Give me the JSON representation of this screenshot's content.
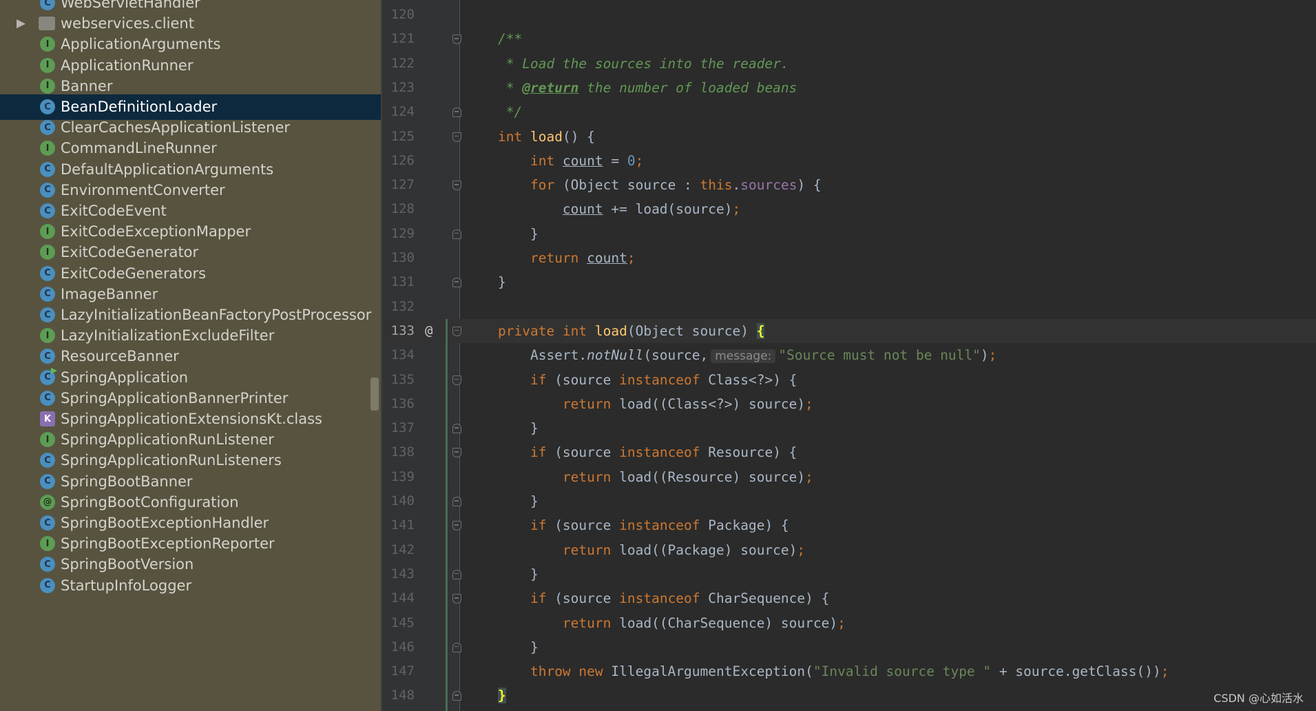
{
  "sidebar": {
    "items": [
      {
        "label": "WebServletHandler",
        "icon": "class-icon",
        "kind": "class",
        "badge": "C",
        "selected": false,
        "arrow": ""
      },
      {
        "label": "webservices.client",
        "icon": "package-icon",
        "kind": "package",
        "badge": "",
        "selected": false,
        "arrow": "▶"
      },
      {
        "label": "ApplicationArguments",
        "icon": "interface-icon",
        "kind": "interface",
        "badge": "I",
        "selected": false,
        "arrow": ""
      },
      {
        "label": "ApplicationRunner",
        "icon": "interface-icon",
        "kind": "interface",
        "badge": "I",
        "selected": false,
        "arrow": ""
      },
      {
        "label": "Banner",
        "icon": "interface-icon",
        "kind": "interface",
        "badge": "I",
        "selected": false,
        "arrow": ""
      },
      {
        "label": "BeanDefinitionLoader",
        "icon": "class-icon",
        "kind": "class",
        "badge": "C",
        "selected": true,
        "arrow": ""
      },
      {
        "label": "ClearCachesApplicationListener",
        "icon": "class-icon",
        "kind": "class",
        "badge": "C",
        "selected": false,
        "arrow": ""
      },
      {
        "label": "CommandLineRunner",
        "icon": "interface-icon",
        "kind": "interface",
        "badge": "I",
        "selected": false,
        "arrow": ""
      },
      {
        "label": "DefaultApplicationArguments",
        "icon": "class-icon",
        "kind": "class",
        "badge": "C",
        "selected": false,
        "arrow": ""
      },
      {
        "label": "EnvironmentConverter",
        "icon": "class-icon",
        "kind": "class",
        "badge": "C",
        "selected": false,
        "arrow": ""
      },
      {
        "label": "ExitCodeEvent",
        "icon": "class-icon",
        "kind": "class",
        "badge": "C",
        "selected": false,
        "arrow": ""
      },
      {
        "label": "ExitCodeExceptionMapper",
        "icon": "interface-icon",
        "kind": "interface",
        "badge": "I",
        "selected": false,
        "arrow": ""
      },
      {
        "label": "ExitCodeGenerator",
        "icon": "interface-icon",
        "kind": "interface",
        "badge": "I",
        "selected": false,
        "arrow": ""
      },
      {
        "label": "ExitCodeGenerators",
        "icon": "class-icon",
        "kind": "class",
        "badge": "C",
        "selected": false,
        "arrow": ""
      },
      {
        "label": "ImageBanner",
        "icon": "class-icon",
        "kind": "class",
        "badge": "C",
        "selected": false,
        "arrow": ""
      },
      {
        "label": "LazyInitializationBeanFactoryPostProcessor",
        "icon": "class-icon",
        "kind": "class",
        "badge": "C",
        "selected": false,
        "arrow": ""
      },
      {
        "label": "LazyInitializationExcludeFilter",
        "icon": "interface-icon",
        "kind": "interface",
        "badge": "I",
        "selected": false,
        "arrow": ""
      },
      {
        "label": "ResourceBanner",
        "icon": "class-icon",
        "kind": "class",
        "badge": "C",
        "selected": false,
        "arrow": ""
      },
      {
        "label": "SpringApplication",
        "icon": "main-class-icon",
        "kind": "class main",
        "badge": "C",
        "selected": false,
        "arrow": ""
      },
      {
        "label": "SpringApplicationBannerPrinter",
        "icon": "class-icon",
        "kind": "class",
        "badge": "C",
        "selected": false,
        "arrow": ""
      },
      {
        "label": "SpringApplicationExtensionsKt.class",
        "icon": "kotlin-file-icon",
        "kind": "kotlin",
        "badge": "K",
        "selected": false,
        "arrow": ""
      },
      {
        "label": "SpringApplicationRunListener",
        "icon": "interface-icon",
        "kind": "interface",
        "badge": "I",
        "selected": false,
        "arrow": ""
      },
      {
        "label": "SpringApplicationRunListeners",
        "icon": "class-icon",
        "kind": "class",
        "badge": "C",
        "selected": false,
        "arrow": ""
      },
      {
        "label": "SpringBootBanner",
        "icon": "class-icon",
        "kind": "class",
        "badge": "C",
        "selected": false,
        "arrow": ""
      },
      {
        "label": "SpringBootConfiguration",
        "icon": "annotation-icon",
        "kind": "annotation",
        "badge": "@",
        "selected": false,
        "arrow": ""
      },
      {
        "label": "SpringBootExceptionHandler",
        "icon": "class-icon",
        "kind": "class",
        "badge": "C",
        "selected": false,
        "arrow": ""
      },
      {
        "label": "SpringBootExceptionReporter",
        "icon": "interface-icon",
        "kind": "interface",
        "badge": "I",
        "selected": false,
        "arrow": ""
      },
      {
        "label": "SpringBootVersion",
        "icon": "class-icon",
        "kind": "class",
        "badge": "C",
        "selected": false,
        "arrow": ""
      },
      {
        "label": "StartupInfoLogger",
        "icon": "class-icon",
        "kind": "class",
        "badge": "C",
        "selected": false,
        "arrow": ""
      }
    ]
  },
  "editor": {
    "current_line": 133,
    "lines": [
      {
        "no": "120",
        "fold": "",
        "html": ""
      },
      {
        "no": "121",
        "fold": "start",
        "html": "<span class=\"cm\">/**</span>"
      },
      {
        "no": "122",
        "fold": "",
        "html": "<span class=\"cm\"> * Load the sources into the reader.</span>"
      },
      {
        "no": "123",
        "fold": "",
        "html": "<span class=\"cm\"> * </span><span class=\"cmtag\">@return</span><span class=\"cm\"> the number of loaded beans</span>"
      },
      {
        "no": "124",
        "fold": "end",
        "html": "<span class=\"cm\"> */</span>"
      },
      {
        "no": "125",
        "fold": "start",
        "html": "<span class=\"kw\">int</span> <span class=\"fn\">load</span>() {"
      },
      {
        "no": "126",
        "fold": "",
        "html": "    <span class=\"kw\">int</span> <span class=\"var\">count</span> = <span class=\"num\">0</span><span class=\"kw\">;</span>"
      },
      {
        "no": "127",
        "fold": "start",
        "html": "    <span class=\"kw\">for</span> (Object source : <span class=\"kw\">this</span>.<span class=\"fld\">sources</span>) {"
      },
      {
        "no": "128",
        "fold": "",
        "html": "        <span class=\"var\">count</span> += load(source)<span class=\"kw\">;</span>"
      },
      {
        "no": "129",
        "fold": "end",
        "html": "    }"
      },
      {
        "no": "130",
        "fold": "",
        "html": "    <span class=\"kw\">return</span> <span class=\"var\">count</span><span class=\"kw\">;</span>"
      },
      {
        "no": "131",
        "fold": "end",
        "html": "}"
      },
      {
        "no": "132",
        "fold": "",
        "html": ""
      },
      {
        "no": "133",
        "fold": "start",
        "marker": "@",
        "html": "<span class=\"kw\">private int</span> <span class=\"fn\">load</span>(Object source) <span class=\"brace-hl\">{</span>"
      },
      {
        "no": "134",
        "fold": "",
        "html": "    Assert.<span class=\"it\">notNull</span>(source,<span class=\"hint\">message:</span><span class=\"str\">\"Source must not be null\"</span>)<span class=\"kw\">;</span>"
      },
      {
        "no": "135",
        "fold": "start",
        "html": "    <span class=\"kw\">if</span> (source <span class=\"kw\">instanceof</span> Class&lt;?&gt;) {"
      },
      {
        "no": "136",
        "fold": "",
        "html": "        <span class=\"kw\">return</span> load((Class&lt;?&gt;) source)<span class=\"kw\">;</span>"
      },
      {
        "no": "137",
        "fold": "end",
        "html": "    }"
      },
      {
        "no": "138",
        "fold": "start",
        "html": "    <span class=\"kw\">if</span> (source <span class=\"kw\">instanceof</span> Resource) {"
      },
      {
        "no": "139",
        "fold": "",
        "html": "        <span class=\"kw\">return</span> load((Resource) source)<span class=\"kw\">;</span>"
      },
      {
        "no": "140",
        "fold": "end",
        "html": "    }"
      },
      {
        "no": "141",
        "fold": "start",
        "html": "    <span class=\"kw\">if</span> (source <span class=\"kw\">instanceof</span> Package) {"
      },
      {
        "no": "142",
        "fold": "",
        "html": "        <span class=\"kw\">return</span> load((Package) source)<span class=\"kw\">;</span>"
      },
      {
        "no": "143",
        "fold": "end",
        "html": "    }"
      },
      {
        "no": "144",
        "fold": "start",
        "html": "    <span class=\"kw\">if</span> (source <span class=\"kw\">instanceof</span> CharSequence) {"
      },
      {
        "no": "145",
        "fold": "",
        "html": "        <span class=\"kw\">return</span> load((CharSequence) source)<span class=\"kw\">;</span>"
      },
      {
        "no": "146",
        "fold": "end",
        "html": "    }"
      },
      {
        "no": "147",
        "fold": "",
        "html": "    <span class=\"kw\">throw new</span> IllegalArgumentException(<span class=\"str\">\"Invalid source type \"</span> + source.getClass())<span class=\"kw\">;</span>"
      },
      {
        "no": "148",
        "fold": "end",
        "html": "<span class=\"brace-hl\">}</span>"
      }
    ]
  },
  "watermark": "CSDN @心如活水",
  "colors": {
    "sidebar_bg": "#57533f",
    "selection_bg": "#0d293e",
    "editor_bg": "#2b2b2b",
    "keyword": "#cc7832",
    "comment": "#629755",
    "method": "#ffc66d",
    "string": "#6a8759",
    "number": "#6897bb",
    "field": "#9876aa"
  }
}
